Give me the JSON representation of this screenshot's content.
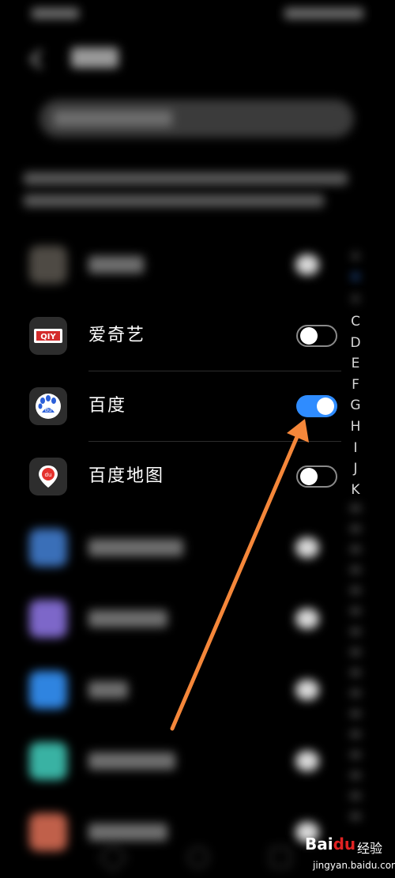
{
  "apps": [
    {
      "name": "爱奇艺",
      "icon": "iqiyi-icon",
      "icon_text": "QIY",
      "toggle": "off"
    },
    {
      "name": "百度",
      "icon": "baidu-icon",
      "icon_text": "du",
      "toggle": "on"
    },
    {
      "name": "百度地图",
      "icon": "baidu-map-icon",
      "icon_text": "du",
      "toggle": "off"
    }
  ],
  "index_letters": [
    "C",
    "D",
    "E",
    "F",
    "G",
    "H",
    "I",
    "J",
    "K"
  ],
  "watermark": {
    "brand_prefix": "Bai",
    "brand_du": "du",
    "brand_cn": "经验",
    "url": "jingyan.baidu.com"
  },
  "colors": {
    "toggle_on": "#2f8cff",
    "arrow": "#f5873a",
    "baidu_red": "#e02222"
  }
}
